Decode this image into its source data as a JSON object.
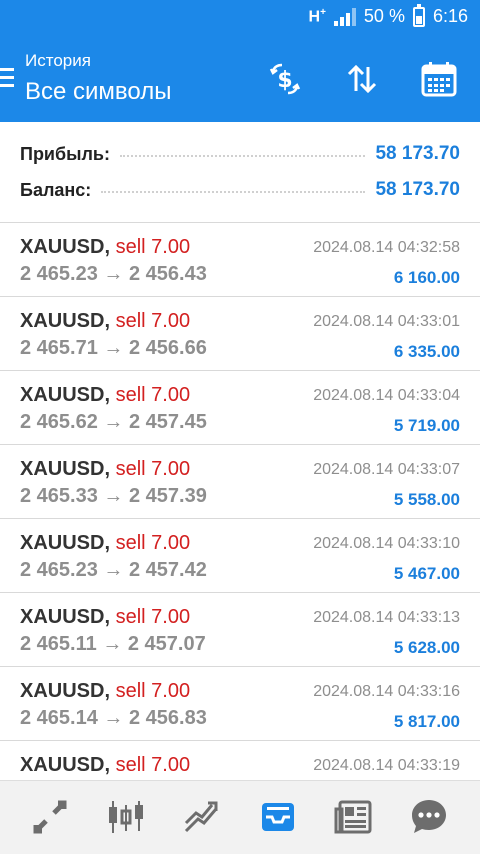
{
  "status_bar": {
    "network": "H",
    "network_sup": "+",
    "battery": "50 %",
    "time": "6:16"
  },
  "header": {
    "subtitle": "История",
    "title": "Все символы",
    "icons": [
      "menu-icon",
      "currency-exchange-icon",
      "sort-icon",
      "calendar-icon"
    ]
  },
  "summary": {
    "profit_label": "Прибыль:",
    "profit_value": "58 173.70",
    "balance_label": "Баланс:",
    "balance_value": "58 173.70"
  },
  "deals": [
    {
      "symbol": "XAUUSD",
      "comma": ",",
      "side": "sell 7.00",
      "open": "2 465.23",
      "arrow": "→",
      "close": "2 456.43",
      "time": "2024.08.14 04:32:58",
      "profit": "6 160.00"
    },
    {
      "symbol": "XAUUSD",
      "comma": ",",
      "side": "sell 7.00",
      "open": "2 465.71",
      "arrow": "→",
      "close": "2 456.66",
      "time": "2024.08.14 04:33:01",
      "profit": "6 335.00"
    },
    {
      "symbol": "XAUUSD",
      "comma": ",",
      "side": "sell 7.00",
      "open": "2 465.62",
      "arrow": "→",
      "close": "2 457.45",
      "time": "2024.08.14 04:33:04",
      "profit": "5 719.00"
    },
    {
      "symbol": "XAUUSD",
      "comma": ",",
      "side": "sell 7.00",
      "open": "2 465.33",
      "arrow": "→",
      "close": "2 457.39",
      "time": "2024.08.14 04:33:07",
      "profit": "5 558.00"
    },
    {
      "symbol": "XAUUSD",
      "comma": ",",
      "side": "sell 7.00",
      "open": "2 465.23",
      "arrow": "→",
      "close": "2 457.42",
      "time": "2024.08.14 04:33:10",
      "profit": "5 467.00"
    },
    {
      "symbol": "XAUUSD",
      "comma": ",",
      "side": "sell 7.00",
      "open": "2 465.11",
      "arrow": "→",
      "close": "2 457.07",
      "time": "2024.08.14 04:33:13",
      "profit": "5 628.00"
    },
    {
      "symbol": "XAUUSD",
      "comma": ",",
      "side": "sell 7.00",
      "open": "2 465.14",
      "arrow": "→",
      "close": "2 456.83",
      "time": "2024.08.14 04:33:16",
      "profit": "5 817.00"
    },
    {
      "symbol": "XAUUSD",
      "comma": ",",
      "side": "sell 7.00",
      "open": "",
      "arrow": "",
      "close": "",
      "time": "2024.08.14 04:33:19",
      "profit": ""
    }
  ],
  "bottom_nav": {
    "items": [
      "quotes-icon",
      "chart-icon",
      "trade-icon",
      "history-icon",
      "news-icon",
      "messages-icon"
    ],
    "active": "history-icon",
    "active_color": "#1c88e8",
    "inactive_color": "#6d6d6d"
  },
  "colors": {
    "accent": "#1c88e8",
    "profit": "#1b7fdc",
    "sell": "#d32020"
  }
}
